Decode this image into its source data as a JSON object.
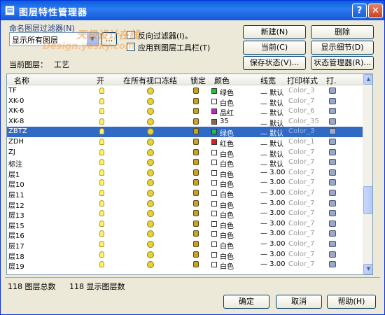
{
  "window": {
    "title": "图层特性管理器",
    "help_symbol": "?",
    "close_symbol": "✕"
  },
  "filter": {
    "label": "命名图层过滤器(N)",
    "value": "显示所有图层",
    "more_button": "...",
    "invert_label": "反向过滤器(I)。",
    "apply_toolbar_label": "应用到图层工具栏(T)"
  },
  "watermark": {
    "line1": "天极设计在线",
    "line2": "Design.yesky.com"
  },
  "current_layer": {
    "label": "当前图层：",
    "value": "工艺"
  },
  "buttons": {
    "new": "新建(N)",
    "delete": "删除",
    "current": "当前(C)",
    "show_details": "显示细节(D)",
    "save_state": "保存状态(V)...",
    "state_manager": "状态管理器(R)...",
    "ok": "确定",
    "cancel": "取消",
    "help": "帮助(H)"
  },
  "columns": [
    "名称",
    "开",
    "在所有视口冻结",
    "锁定",
    "颜色",
    "线宽",
    "打印样式",
    "打."
  ],
  "layers": [
    {
      "name": "TF",
      "color_name": "绿色",
      "color": "#22c040",
      "lineweight": "— 默认",
      "plotstyle": "Color_3"
    },
    {
      "name": "XK-0",
      "color_name": "白色",
      "color": "#ffffff",
      "lineweight": "— 默认",
      "plotstyle": "Color_7"
    },
    {
      "name": "XK-6",
      "color_name": "品红",
      "color": "#d020c0",
      "lineweight": "— 默认",
      "plotstyle": "Color_6"
    },
    {
      "name": "XK-8",
      "color_name": "35",
      "color": "#8a6a4a",
      "lineweight": "— 默认",
      "plotstyle": "Color_35"
    },
    {
      "name": "ZBTZ",
      "color_name": "绿色",
      "color": "#22c040",
      "lineweight": "— 默认",
      "plotstyle": "Color_3",
      "selected": true
    },
    {
      "name": "ZDH",
      "color_name": "红色",
      "color": "#e02020",
      "lineweight": "— 默认",
      "plotstyle": "Color_1"
    },
    {
      "name": "ZJ",
      "color_name": "白色",
      "color": "#ffffff",
      "lineweight": "— 默认",
      "plotstyle": "Color_7"
    },
    {
      "name": "标注",
      "color_name": "白色",
      "color": "#ffffff",
      "lineweight": "— 默认",
      "plotstyle": "Color_7"
    },
    {
      "name": "层1",
      "color_name": "白色",
      "color": "#ffffff",
      "lineweight": "— 3.00",
      "plotstyle": "Color_7"
    },
    {
      "name": "层10",
      "color_name": "白色",
      "color": "#ffffff",
      "lineweight": "— 3.00",
      "plotstyle": "Color_7"
    },
    {
      "name": "层11",
      "color_name": "白色",
      "color": "#ffffff",
      "lineweight": "— 3.00",
      "plotstyle": "Color_7"
    },
    {
      "name": "层12",
      "color_name": "白色",
      "color": "#ffffff",
      "lineweight": "— 3.00",
      "plotstyle": "Color_7"
    },
    {
      "name": "层13",
      "color_name": "白色",
      "color": "#ffffff",
      "lineweight": "— 3.00",
      "plotstyle": "Color_7"
    },
    {
      "name": "层15",
      "color_name": "白色",
      "color": "#ffffff",
      "lineweight": "— 3.00",
      "plotstyle": "Color_7"
    },
    {
      "name": "层16",
      "color_name": "白色",
      "color": "#ffffff",
      "lineweight": "— 3.00",
      "plotstyle": "Color_7"
    },
    {
      "name": "层17",
      "color_name": "白色",
      "color": "#ffffff",
      "lineweight": "— 3.00",
      "plotstyle": "Color_7"
    },
    {
      "name": "层18",
      "color_name": "白色",
      "color": "#ffffff",
      "lineweight": "— 3.00",
      "plotstyle": "Color_7"
    },
    {
      "name": "层19",
      "color_name": "白色",
      "color": "#ffffff",
      "lineweight": "— 3.00",
      "plotstyle": "Color_7"
    }
  ],
  "status": {
    "total": "118 图层总数",
    "shown": "118 显示图层数"
  },
  "colors": {
    "selection": "#316ac5",
    "titlebar": "#0a5fdc"
  }
}
